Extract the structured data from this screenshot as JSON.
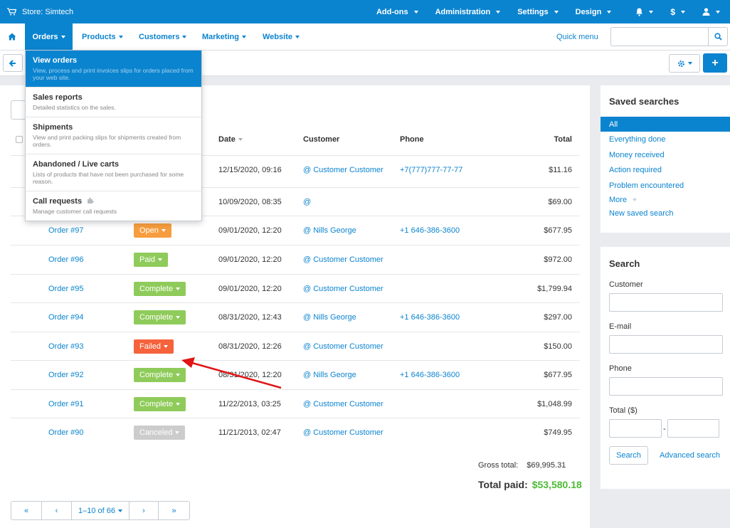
{
  "topbar": {
    "store": "Store: Simtech",
    "items": [
      "Add-ons",
      "Administration",
      "Settings",
      "Design"
    ]
  },
  "nav": {
    "orders": "Orders",
    "products": "Products",
    "customers": "Customers",
    "marketing": "Marketing",
    "website": "Website",
    "quick_menu": "Quick menu"
  },
  "dropdown": [
    {
      "title": "View orders",
      "desc": "View, process and print invoices slips for orders placed from your web site."
    },
    {
      "title": "Sales reports",
      "desc": "Detailed statistics on the sales."
    },
    {
      "title": "Shipments",
      "desc": "View and print packing slips for shipments created from orders."
    },
    {
      "title": "Abandoned / Live carts",
      "desc": "Lists of products that have not been purchased for some reason."
    },
    {
      "title": "Call requests",
      "desc": "Manage customer call requests"
    }
  ],
  "table": {
    "headers": {
      "date": "Date",
      "customer": "Customer",
      "phone": "Phone",
      "total": "Total"
    },
    "rows": [
      {
        "order": "",
        "status": "",
        "date": "12/15/2020, 09:16",
        "customer": "@ Customer Customer",
        "phone": "+7(777)777-77-77",
        "total": "$11.16"
      },
      {
        "order": "",
        "status": "",
        "date": "10/09/2020, 08:35",
        "customer": "@",
        "phone": "",
        "total": "$69.00"
      },
      {
        "order": "Order #97",
        "status": "Open",
        "date": "09/01/2020, 12:20",
        "customer": "@ Nills George",
        "phone": "+1 646-386-3600",
        "total": "$677.95"
      },
      {
        "order": "Order #96",
        "status": "Paid",
        "date": "09/01/2020, 12:20",
        "customer": "@ Customer Customer",
        "phone": "",
        "total": "$972.00"
      },
      {
        "order": "Order #95",
        "status": "Complete",
        "date": "09/01/2020, 12:20",
        "customer": "@ Customer Customer",
        "phone": "",
        "total": "$1,799.94"
      },
      {
        "order": "Order #94",
        "status": "Complete",
        "date": "08/31/2020, 12:43",
        "customer": "@ Nills George",
        "phone": "+1 646-386-3600",
        "total": "$297.00"
      },
      {
        "order": "Order #93",
        "status": "Failed",
        "date": "08/31/2020, 12:26",
        "customer": "@ Customer Customer",
        "phone": "",
        "total": "$150.00"
      },
      {
        "order": "Order #92",
        "status": "Complete",
        "date": "08/31/2020, 12:20",
        "customer": "@ Nills George",
        "phone": "+1 646-386-3600",
        "total": "$677.95"
      },
      {
        "order": "Order #91",
        "status": "Complete",
        "date": "11/22/2013, 03:25",
        "customer": "@ Customer Customer",
        "phone": "",
        "total": "$1,048.99"
      },
      {
        "order": "Order #90",
        "status": "Canceled",
        "date": "11/21/2013, 02:47",
        "customer": "@ Customer Customer",
        "phone": "",
        "total": "$749.95"
      }
    ]
  },
  "status_colors": {
    "Open": "#f79d3f",
    "Paid": "#8fcb5a",
    "Complete": "#8fcb5a",
    "Failed": "#f5623c",
    "Canceled": "#cccccc"
  },
  "totals": {
    "gross_label": "Gross total:",
    "gross_value": "$69,995.31",
    "paid_label": "Total paid:",
    "paid_value": "$53,580.18"
  },
  "pagination": {
    "first": "«",
    "prev": "‹",
    "range": "1–10 of 66",
    "next": "›",
    "last": "»"
  },
  "saved_searches": {
    "title": "Saved searches",
    "items": [
      "All",
      "Everything done",
      "Money received",
      "Action required",
      "Problem encountered",
      "More",
      "New saved search"
    ]
  },
  "search": {
    "title": "Search",
    "customer_label": "Customer",
    "email_label": "E-mail",
    "phone_label": "Phone",
    "total_label": "Total ($)",
    "total_sep": "-",
    "search_button": "Search",
    "advanced_link": "Advanced search"
  }
}
